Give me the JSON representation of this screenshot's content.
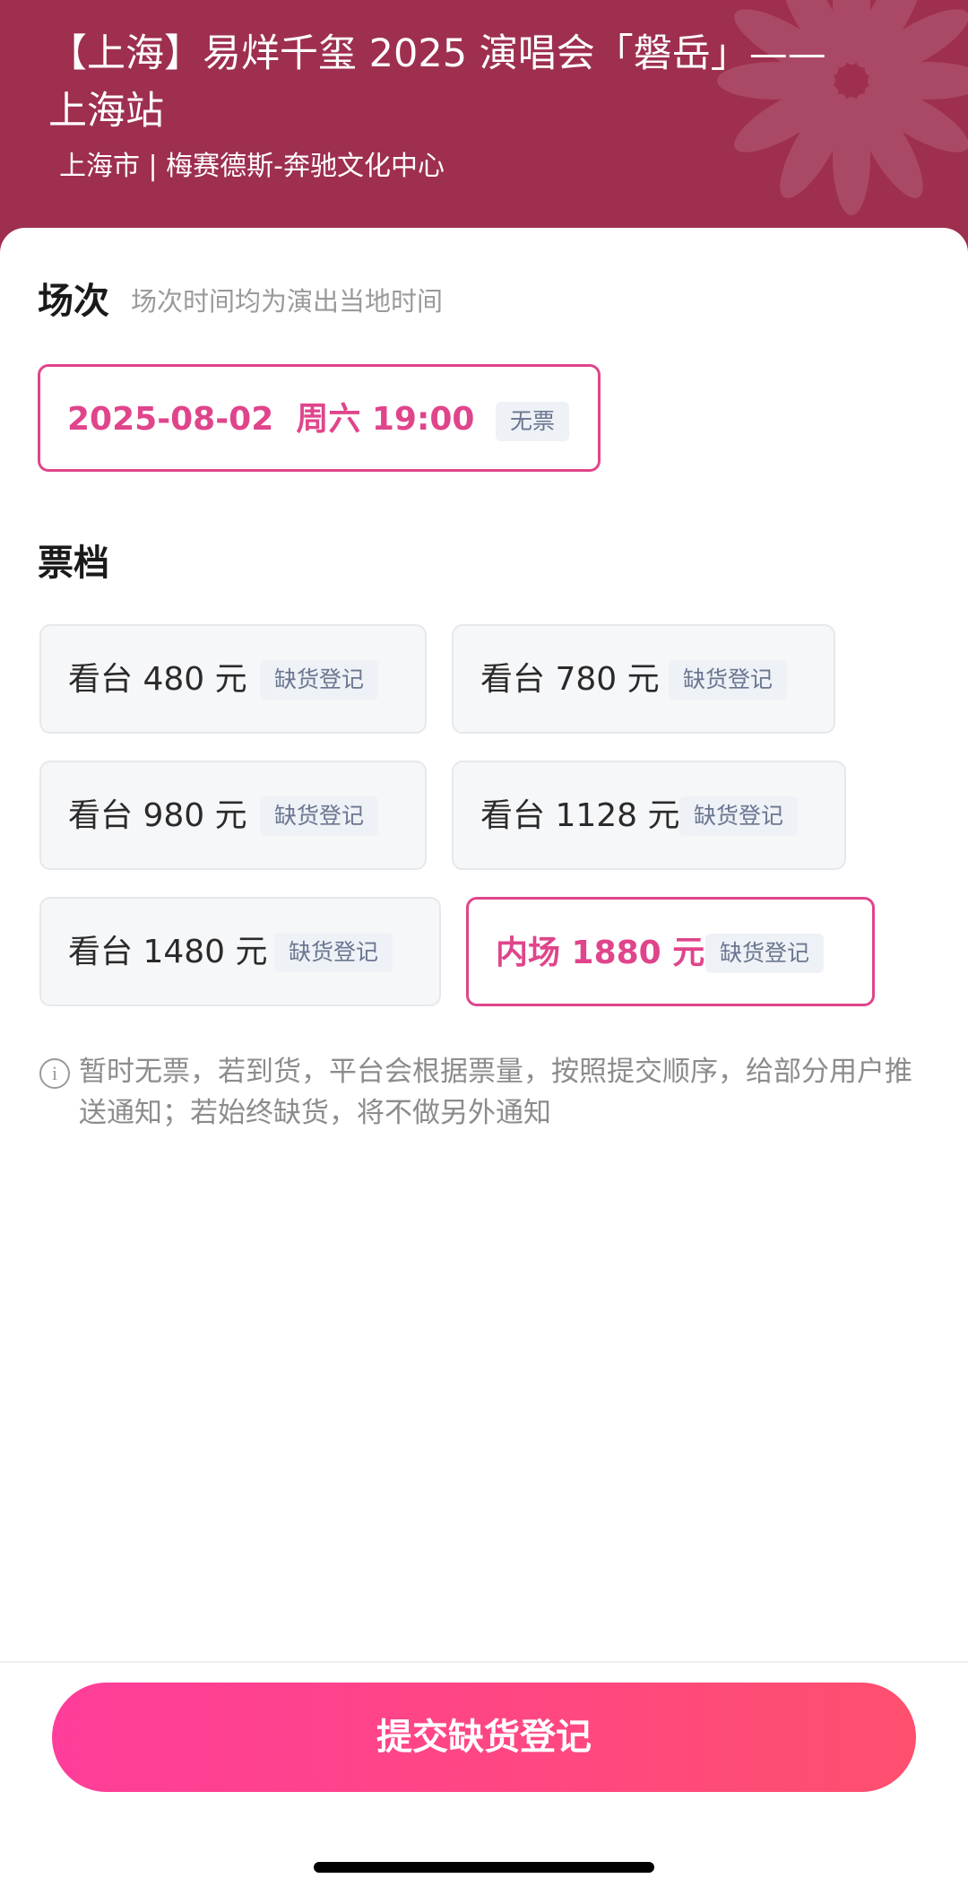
{
  "header": {
    "title": "【上海】易烊千玺 2025 演唱会「磐岳」——上海站",
    "venue": "上海市 | 梅赛德斯-奔驰文化中心",
    "bg_color": "#9e2f4f"
  },
  "session": {
    "section_title": "场次",
    "hint": "场次时间均为演出当地时间",
    "option_text": "2025-08-02  周六 19:00",
    "option_tag": "无票",
    "selected": true
  },
  "tiers": {
    "section_title": "票档",
    "items": [
      {
        "label": "看台 480 元",
        "tag": "缺货登记",
        "selected": false
      },
      {
        "label": "看台 780 元",
        "tag": "缺货登记",
        "selected": false
      },
      {
        "label": "看台 980 元",
        "tag": "缺货登记",
        "selected": false
      },
      {
        "label": "看台 1128 元",
        "tag": "缺货登记",
        "selected": false
      },
      {
        "label": "看台 1480 元",
        "tag": "缺货登记",
        "selected": false
      },
      {
        "label": "内场 1880 元",
        "tag": "缺货登记",
        "selected": true
      }
    ]
  },
  "notice": {
    "icon": "info-icon",
    "text": "暂时无票，若到货，平台会根据票量，按照提交顺序，给部分用户推送通知；若始终缺货，将不做另外通知"
  },
  "footer": {
    "submit_label": "提交缺货登记"
  },
  "colors": {
    "accent": "#e0458b",
    "button_gradient_start": "#ff3d9a",
    "button_gradient_end": "#ff4f6e"
  }
}
